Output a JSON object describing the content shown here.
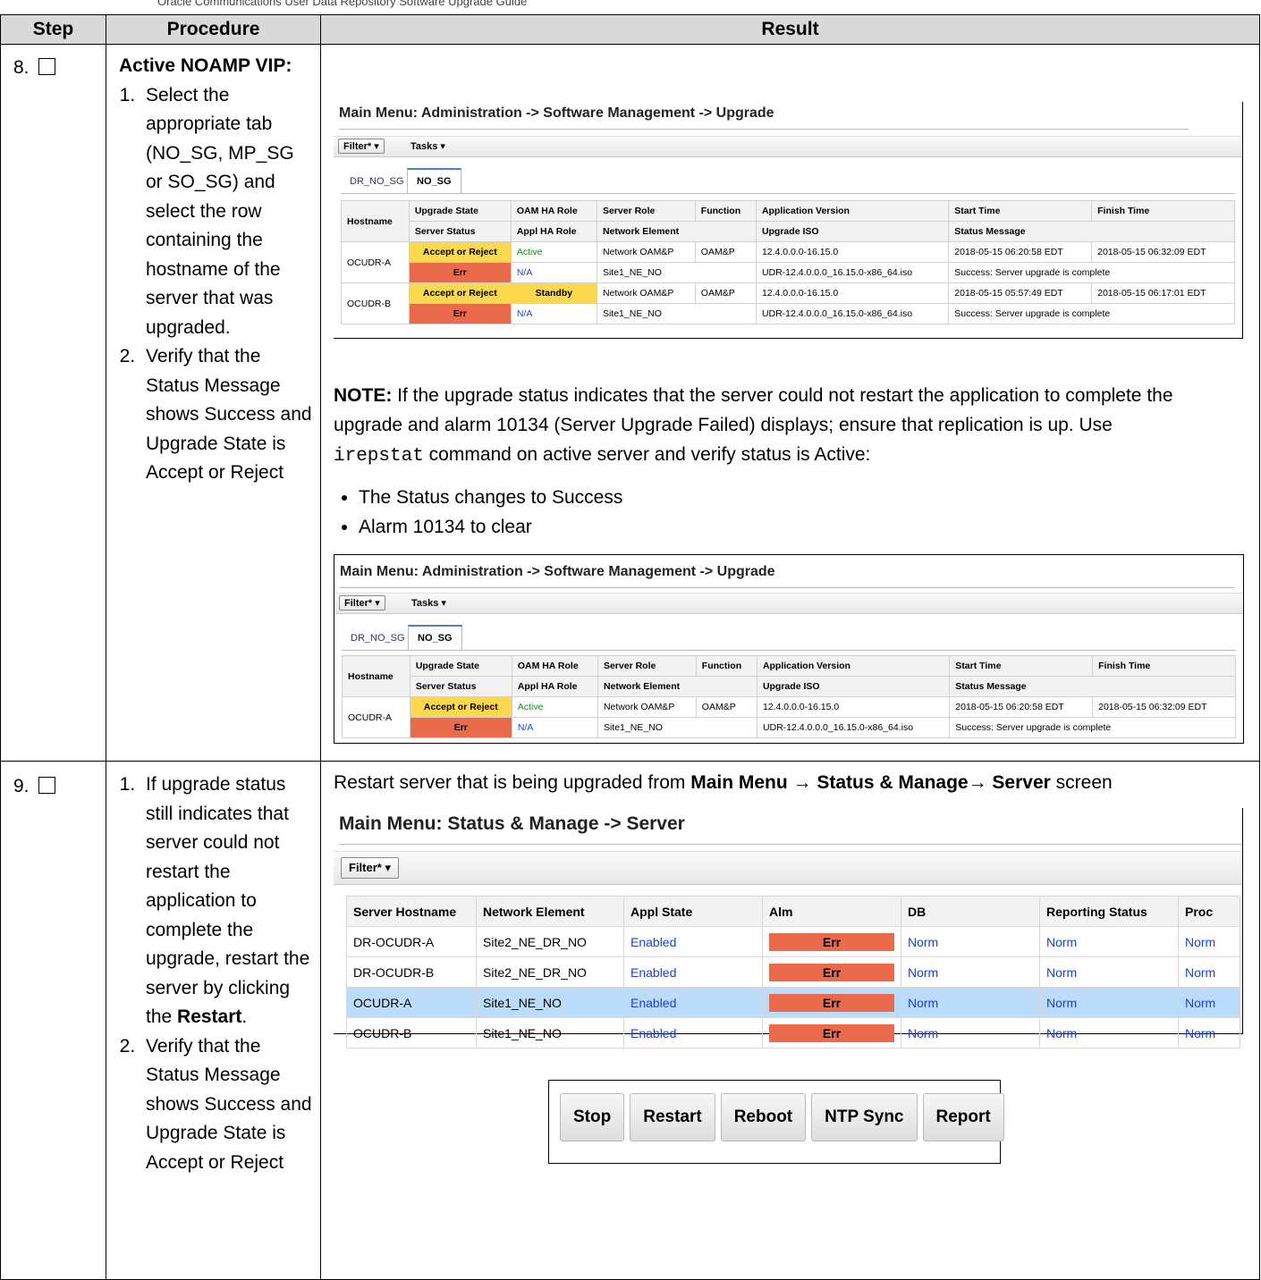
{
  "page": {
    "top_caption": "Oracle Communications User Data Repository Software Upgrade Guide"
  },
  "headers": {
    "step": "Step",
    "procedure": "Procedure",
    "result": "Result"
  },
  "step8": {
    "number": "8.",
    "proc_title": "Active NOAMP VIP:",
    "proc_items": [
      "Select the appropriate tab (NO_SG, MP_SG or SO_SG) and select the row containing the hostname of the server that was upgraded.",
      "Verify that the Status Message shows Success and Upgrade State is Accept or Reject"
    ],
    "shot1": {
      "title": "Main Menu: Administration -> Software Management -> Upgrade",
      "filter": "Filter* ▾",
      "tasks": "Tasks ▾",
      "tabs": [
        "DR_NO_SG",
        "NO_SG"
      ],
      "head1": [
        "Hostname",
        "Upgrade State",
        "OAM HA Role",
        "Server Role",
        "Function",
        "Application Version",
        "Start Time",
        "Finish Time"
      ],
      "head2": [
        "Server Status",
        "Appl HA Role",
        "Network Element",
        "Upgrade ISO",
        "Status Message"
      ],
      "rows": [
        {
          "host": "OCUDR-A",
          "state": "Accept or Reject",
          "oam": "Active",
          "role": "Network OAM&P",
          "func": "OAM&P",
          "ver": "12.4.0.0.0-16.15.0",
          "start": "2018-05-15 06:20:58 EDT",
          "finish": "2018-05-15 06:32:09 EDT",
          "status": "Err",
          "appl": "N/A",
          "ne": "Site1_NE_NO",
          "iso": "UDR-12.4.0.0.0_16.15.0-x86_64.iso",
          "msg": "Success: Server upgrade is complete"
        },
        {
          "host": "OCUDR-B",
          "state": "Accept or Reject",
          "oam": "Standby",
          "role": "Network OAM&P",
          "func": "OAM&P",
          "ver": "12.4.0.0.0-16.15.0",
          "start": "2018-05-15 05:57:49 EDT",
          "finish": "2018-05-15 06:17:01 EDT",
          "status": "Err",
          "appl": "N/A",
          "ne": "Site1_NE_NO",
          "iso": "UDR-12.4.0.0.0_16.15.0-x86_64.iso",
          "msg": "Success: Server upgrade is complete"
        }
      ]
    },
    "note_label": "NOTE:",
    "note_text_1": " If the upgrade status indicates that the server could not restart the application to complete the upgrade and alarm 10134 (Server Upgrade Failed) displays; ensure that replication is up. Use ",
    "note_cmd": "irepstat",
    "note_text_2": " command on active server and verify status is Active:",
    "bullets": [
      "The Status changes to Success",
      "Alarm 10134 to clear"
    ],
    "shot2": {
      "title": "Main Menu: Administration -> Software Management -> Upgrade",
      "filter": "Filter* ▾",
      "tasks": "Tasks ▾",
      "tabs": [
        "DR_NO_SG",
        "NO_SG"
      ],
      "row": {
        "host": "OCUDR-A",
        "state": "Accept or Reject",
        "oam": "Active",
        "role": "Network OAM&P",
        "func": "OAM&P",
        "ver": "12.4.0.0.0-16.15.0",
        "start": "2018-05-15 06:20:58 EDT",
        "finish": "2018-05-15 06:32:09 EDT",
        "status": "Err",
        "appl": "N/A",
        "ne": "Site1_NE_NO",
        "iso": "UDR-12.4.0.0.0_16.15.0-x86_64.iso",
        "msg": "Success: Server upgrade is complete"
      }
    }
  },
  "step9": {
    "number": "9.",
    "proc_item1_a": "If upgrade status still indicates that server could not restart the application to complete the upgrade, restart the server by clicking the ",
    "proc_item1_b": "Restart",
    "proc_item1_c": ".",
    "proc_item2": "Verify that the Status Message shows Success and Upgrade State is Accept or Reject",
    "instr_a": "Restart server that is being upgraded from ",
    "instr_b": "Main Menu ",
    "instr_arrow": "→",
    "instr_c": " Status & Manage",
    "instr_d": " Server",
    "instr_e": " screen",
    "shot": {
      "title": "Main Menu: Status & Manage -> Server",
      "filter": "Filter* ▾",
      "headers": [
        "Server Hostname",
        "Network Element",
        "Appl State",
        "Alm",
        "DB",
        "Reporting Status",
        "Proc"
      ],
      "rows": [
        {
          "host": "DR-OCUDR-A",
          "ne": "Site2_NE_DR_NO",
          "appl": "Enabled",
          "alm": "Err",
          "db": "Norm",
          "rep": "Norm",
          "proc": "Norm"
        },
        {
          "host": "DR-OCUDR-B",
          "ne": "Site2_NE_DR_NO",
          "appl": "Enabled",
          "alm": "Err",
          "db": "Norm",
          "rep": "Norm",
          "proc": "Norm"
        },
        {
          "host": "OCUDR-A",
          "ne": "Site1_NE_NO",
          "appl": "Enabled",
          "alm": "Err",
          "db": "Norm",
          "rep": "Norm",
          "proc": "Norm"
        },
        {
          "host": "OCUDR-B",
          "ne": "Site1_NE_NO",
          "appl": "Enabled",
          "alm": "Err",
          "db": "Norm",
          "rep": "Norm",
          "proc": "Norm"
        }
      ]
    },
    "buttons": [
      "Stop",
      "Restart",
      "Reboot",
      "NTP Sync",
      "Report"
    ]
  }
}
